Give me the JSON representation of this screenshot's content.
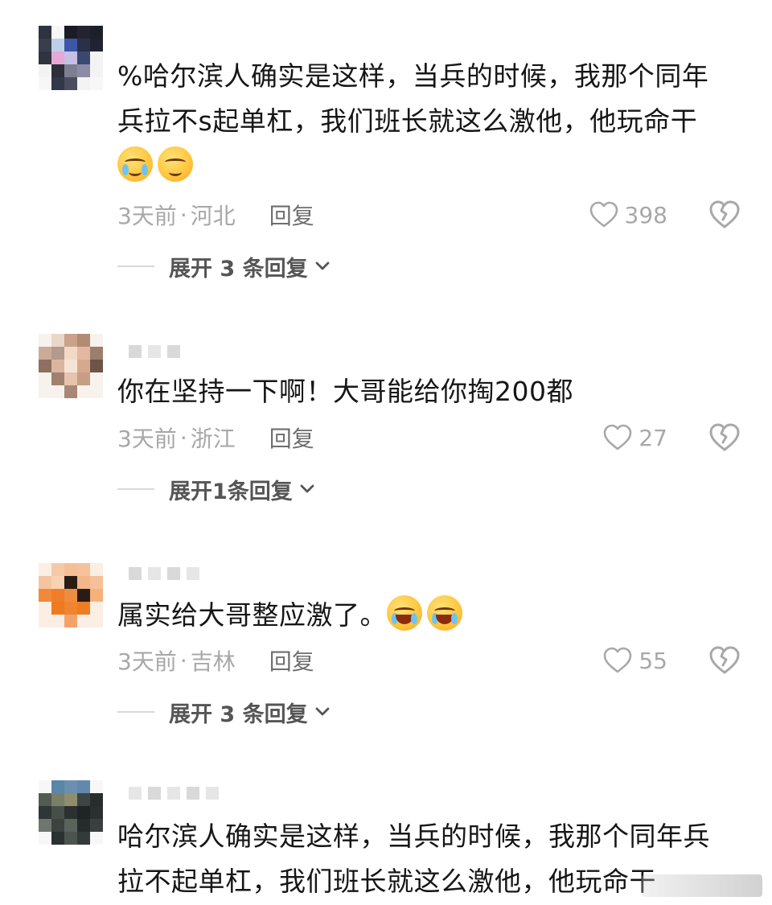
{
  "comments": [
    {
      "text_line1": "%哈尔滨人确实是这样，当兵的时候，我那个同年",
      "text_line2": "兵拉不s起单杠，我们班长就这么激他，他玩命干",
      "emojis": [
        "pleading-tears-emoji",
        "smiling-emoji"
      ],
      "time": "3天前",
      "sep": "·",
      "location": "河北",
      "reply": "回复",
      "likes": "398",
      "expand": "展开 3 条回复"
    },
    {
      "text_line1": "你在坚持一下啊！大哥能给你掏200都",
      "time": "3天前",
      "sep": "·",
      "location": "浙江",
      "reply": "回复",
      "likes": "27",
      "expand": "展开1条回复"
    },
    {
      "text_line1": "属实给大哥整应激了。",
      "emojis": [
        "laughing-crying-emoji",
        "laughing-crying-emoji"
      ],
      "time": "3天前",
      "sep": "·",
      "location": "吉林",
      "reply": "回复",
      "likes": "55",
      "expand": "展开 3 条回复"
    },
    {
      "text_line1": "哈尔滨人确实是这样，当兵的时候，我那个同年兵",
      "text_line2": "拉不起单杠，我们班长就这么激他，他玩命干"
    }
  ],
  "colors": {
    "text": "#161616",
    "meta": "#a8a8a8",
    "reply": "#6e6e6e",
    "expand": "#555555"
  },
  "icons": [
    "heart-outline-icon",
    "broken-heart-icon",
    "chevron-down-icon"
  ]
}
